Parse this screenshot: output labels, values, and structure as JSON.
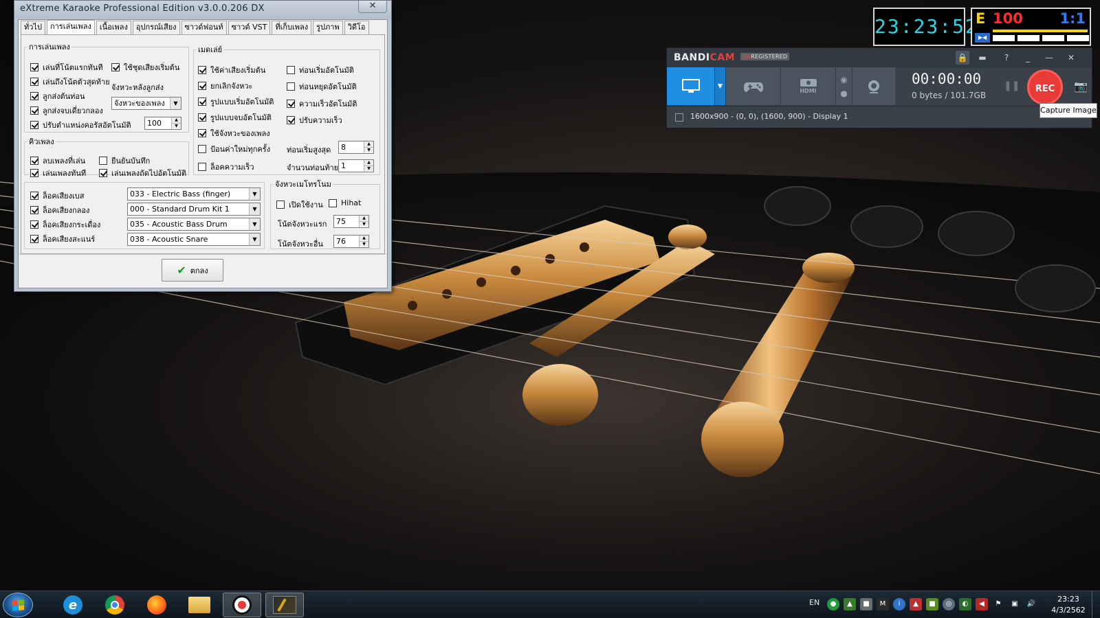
{
  "karaoke_window": {
    "title": "eXtreme Karaoke Professional Edition v3.0.0.206 DX",
    "close_glyph": "✕",
    "tabs": [
      {
        "label": "ทั่วไป"
      },
      {
        "label": "การเล่นเพลง",
        "active": true
      },
      {
        "label": "เนื้อเพลง"
      },
      {
        "label": "อุปกรณ์เสียง"
      },
      {
        "label": "ซาวด์ฟอนท์"
      },
      {
        "label": "ซาวด์ VST"
      },
      {
        "label": "ที่เก็บเพลง"
      },
      {
        "label": "รูปภาพ"
      },
      {
        "label": "วิดีโอ"
      }
    ],
    "playback_group": {
      "legend": "การเล่นเพลง",
      "play_from_first_note": {
        "label": "เล่นที่โน้ตแรกทันที",
        "checked": true
      },
      "use_intro_sound": {
        "label": "ใช้ชุดเสียงเริ่มต้น",
        "checked": true
      },
      "play_to_last_note": {
        "label": "เล่นถึงโน้ตตัวสุดท้าย",
        "checked": true
      },
      "send_rhythm_label": "จังหวะหลังลูกส่ง",
      "intro_send": {
        "label": "ลูกส่งต้นท่อน",
        "checked": true
      },
      "end_drum_only": {
        "label": "ลูกส่งจบเดี่ยวกลอง",
        "checked": true
      },
      "rhythm_select": "จังหวะของเพลง",
      "auto_chorus": {
        "label": "ปรับตำแหน่งคอรัสอัตโนมัติ",
        "checked": true
      },
      "auto_chorus_value": "100"
    },
    "queue_group": {
      "legend": "คิวเพลง",
      "remove_played": {
        "label": "ลบเพลงที่เล่น",
        "checked": true
      },
      "confirm_save": {
        "label": "ยืนยันบันทึก",
        "checked": false
      },
      "play_now": {
        "label": "เล่นเพลงทันที",
        "checked": true
      },
      "auto_next": {
        "label": "เล่นเพลงถัดไปอัตโนมัติ",
        "checked": true
      }
    },
    "medley_group": {
      "legend": "เมดเล่ย์",
      "use_start_sound": {
        "label": "ใช้ค่าเสียงเริ่มต้น",
        "checked": true
      },
      "auto_start_bar": {
        "label": "ท่อนเริ่มอัตโนมัติ",
        "checked": false
      },
      "cancel_rhythm": {
        "label": "ยกเลิกจังหวะ",
        "checked": true
      },
      "auto_stop_bar": {
        "label": "ท่อนหยุดอัตโนมัติ",
        "checked": false
      },
      "auto_start_pattern": {
        "label": "รูปแบบเริ่มอัตโนมัติ",
        "checked": true
      },
      "auto_speed": {
        "label": "ความเร็วอัตโนมัติ",
        "checked": true
      },
      "auto_end_pattern": {
        "label": "รูปแบบจบอัตโนมัติ",
        "checked": true
      },
      "adjust_speed": {
        "label": "ปรับความเร็ว",
        "checked": true
      },
      "use_song_rhythm": {
        "label": "ใช้จังหวะของเพลง",
        "checked": true
      },
      "new_value_each": {
        "label": "ป้อนค่าใหม่ทุกครั้ง",
        "checked": false
      },
      "max_start_bars_label": "ท่อนเริ่มสูงสุด",
      "max_start_bars_value": "8",
      "lock_speed": {
        "label": "ล็อคความเร็ว",
        "checked": false
      },
      "last_bars_label": "จำนวนท่อนท้าย",
      "last_bars_value": "1"
    },
    "instrument_group": {
      "rows": [
        {
          "label": "ล็อคเสียงเบส",
          "checked": true,
          "value": "033 - Electric Bass (finger)"
        },
        {
          "label": "ล็อคเสียงกลอง",
          "checked": true,
          "value": "000 - Standard Drum Kit 1"
        },
        {
          "label": "ล็อคเสียงกระเดื่อง",
          "checked": true,
          "value": "035 - Acoustic Bass Drum"
        },
        {
          "label": "ล็อคเสียงสะแนร์",
          "checked": true,
          "value": "038 - Acoustic Snare"
        }
      ]
    },
    "metronome_group": {
      "legend": "จังหวะเมโทรโนม",
      "enable": {
        "label": "เปิดใช้งาน",
        "checked": false
      },
      "hihat": {
        "label": "Hihat",
        "checked": false
      },
      "first_beat_note_label": "โน้ตจังหวะแรก",
      "first_beat_note_value": "75",
      "other_beat_note_label": "โน้ตจังหวะอื่น",
      "other_beat_note_value": "76"
    },
    "ok_label": "ตกลง"
  },
  "clock_display": {
    "time": "23:23:52",
    "color": "#27d7e5"
  },
  "score_display": {
    "prefix": "E",
    "score": "100",
    "ratio": "1:1",
    "icon": "▶◀"
  },
  "bandicam": {
    "logo_main": "BANDI",
    "logo_accent": "CAM",
    "unreg_prefix": "UN",
    "unreg_rest": "REGISTERED",
    "timer": "00:00:00",
    "size": "0 bytes / 101.7GB",
    "rec_label": "REC",
    "region": "1600x900 - (0, 0), (1600, 900) - Display 1",
    "tooltip": "Capture Image",
    "mode_hdmi_label": "HDMI",
    "accent_color": "#1f8ee3",
    "rec_color": "#e83a36"
  },
  "taskbar": {
    "language": "EN",
    "time": "23:23",
    "date": "4/3/2562",
    "apps": [
      {
        "name": "internet-explorer"
      },
      {
        "name": "chrome"
      },
      {
        "name": "firefox"
      },
      {
        "name": "file-explorer"
      },
      {
        "name": "bandicam",
        "active": true
      },
      {
        "name": "extreme-karaoke",
        "active": true
      }
    ]
  }
}
